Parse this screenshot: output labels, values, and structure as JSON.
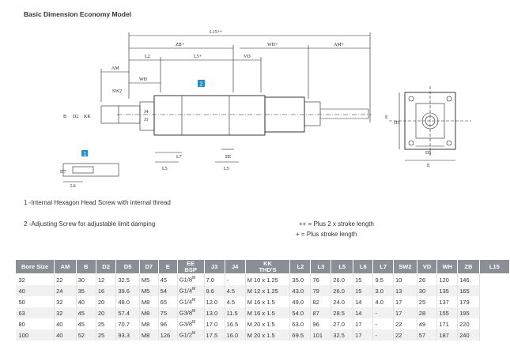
{
  "title": "Basic Dimension  Economy Model",
  "drawing_labels": {
    "L15": "L15++",
    "ZB": "ZB+",
    "WH_top": "WH+",
    "AM_top": "AM+",
    "AM": "AM",
    "L2": "L2",
    "L5": "L5+",
    "VD": "VD",
    "WH": "WH",
    "SW2": "SW2",
    "B": "B",
    "D2": "D2",
    "KK": "KK",
    "J4": "J4",
    "J3": "J3",
    "L7": "L7",
    "EE": "EE",
    "L5a": "L5",
    "L5b": "L5",
    "E": "E",
    "D5": "D5",
    "L6": "L6",
    "D7": "D7",
    "badge1": "1",
    "badge2": "2"
  },
  "notes": {
    "note1": "1 -Internal Hexagon Head Screw with internal thread",
    "note2": "2 -Adjusting Screw for adjustable limit damping",
    "plus2": "++ = Plus 2 x stroke length",
    "plus1": "+ = Plus stroke length"
  },
  "table": {
    "headers": [
      "Bore Size",
      "AM",
      "B",
      "D2",
      "D5",
      "D7",
      "E",
      "EE\nBSP",
      "J3",
      "J4",
      "KK\nTHD'S",
      "L2",
      "L3",
      "L5",
      "L6",
      "L7",
      "SW2",
      "VD",
      "WH",
      "ZB",
      "L15"
    ],
    "rows": [
      [
        "32",
        "22",
        "30",
        "12",
        "32.5",
        "M5",
        "45",
        "G1/8",
        "M",
        "7.0",
        "-",
        "M 10 x 1.25",
        "35.0",
        "76",
        "26.0",
        "15",
        "9.5",
        "10",
        "26",
        "120",
        "146"
      ],
      [
        "40",
        "24",
        "35",
        "16",
        "39.6",
        "M5",
        "54",
        "G1/4",
        "M",
        "9.6",
        "4.5",
        "M 12 x 1.25",
        "43.0",
        "79",
        "26.0",
        "15",
        "3.0",
        "13",
        "30",
        "135",
        "165"
      ],
      [
        "50",
        "32",
        "40",
        "20",
        "48.0",
        "M8",
        "65",
        "G1/4",
        "M",
        "12.0",
        "4.5",
        "M 16 x 1.5",
        "49.0",
        "82",
        "24.0",
        "14",
        "4.0",
        "17",
        "25",
        "137",
        "179"
      ],
      [
        "63",
        "32",
        "45",
        "20",
        "57.4",
        "M8",
        "75",
        "G3/8",
        "M",
        "13.0",
        "11.5",
        "M 16 x 1.5",
        "54.0",
        "87",
        "28.5",
        "14",
        "-",
        "17",
        "28",
        "155",
        "195"
      ],
      [
        "80",
        "40",
        "45",
        "25",
        "70.7",
        "M8",
        "96",
        "G3/8",
        "M",
        "17.0",
        "16.5",
        "M 20 x 1.5",
        "63.0",
        "96",
        "27.0",
        "17",
        "-",
        "22",
        "49",
        "171",
        "220"
      ],
      [
        "100",
        "40",
        "52",
        "25",
        "93.3",
        "M8",
        "126",
        "G1/2",
        "M",
        "17.5",
        "16.0",
        "M 20 x 1.5",
        "69.5",
        "101",
        "32.5",
        "17",
        "-",
        "22",
        "57",
        "187",
        "240"
      ]
    ]
  }
}
